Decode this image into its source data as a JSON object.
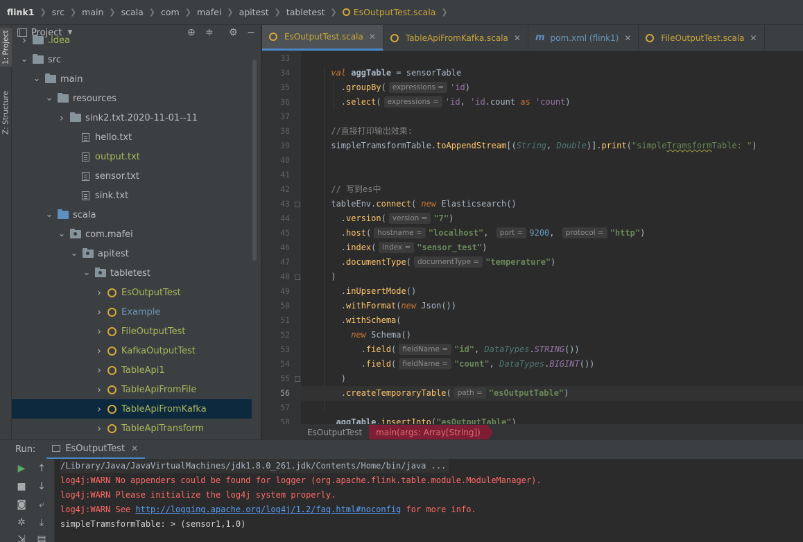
{
  "breadcrumb": {
    "items": [
      "flink1",
      "src",
      "main",
      "scala",
      "com",
      "mafei",
      "apitest",
      "tabletest"
    ],
    "file": "EsOutputTest.scala"
  },
  "toolstrip": {
    "project_tab": "1: Project",
    "structure_tab": "Z: Structure"
  },
  "project_panel": {
    "title": "Project",
    "tree": [
      {
        "label": ".idea",
        "kind": "folder",
        "arrow": "right",
        "color": "olive"
      },
      {
        "label": "src",
        "kind": "folder",
        "arrow": "down",
        "color": "white"
      },
      {
        "label": "main",
        "kind": "folder",
        "arrow": "down",
        "color": "white"
      },
      {
        "label": "resources",
        "kind": "folder",
        "arrow": "down",
        "color": "white"
      },
      {
        "label": "sink2.txt.2020-11-01--11",
        "kind": "folder",
        "arrow": "right",
        "color": "white"
      },
      {
        "label": "hello.txt",
        "kind": "file",
        "arrow": "none",
        "color": "white"
      },
      {
        "label": "output.txt",
        "kind": "file",
        "arrow": "none",
        "color": "olive"
      },
      {
        "label": "sensor.txt",
        "kind": "file",
        "arrow": "none",
        "color": "white"
      },
      {
        "label": "sink.txt",
        "kind": "file",
        "arrow": "none",
        "color": "white"
      },
      {
        "label": "scala",
        "kind": "folder-blue",
        "arrow": "down",
        "color": "white"
      },
      {
        "label": "com.mafei",
        "kind": "package",
        "arrow": "down",
        "color": "white"
      },
      {
        "label": "apitest",
        "kind": "package",
        "arrow": "down",
        "color": "white"
      },
      {
        "label": "tabletest",
        "kind": "package",
        "arrow": "down",
        "color": "white"
      },
      {
        "label": "EsOutputTest",
        "kind": "scala",
        "arrow": "right",
        "color": "olive"
      },
      {
        "label": "Example",
        "kind": "scala",
        "arrow": "right",
        "color": "blue"
      },
      {
        "label": "FileOutputTest",
        "kind": "scala",
        "arrow": "right",
        "color": "olive"
      },
      {
        "label": "KafkaOutputTest",
        "kind": "scala",
        "arrow": "right",
        "color": "olive"
      },
      {
        "label": "TableApi1",
        "kind": "scala",
        "arrow": "right",
        "color": "olive"
      },
      {
        "label": "TableApiFromFile",
        "kind": "scala",
        "arrow": "right",
        "color": "olive"
      },
      {
        "label": "TableApiFromKafka",
        "kind": "scala",
        "arrow": "right",
        "color": "olive",
        "selected": true
      },
      {
        "label": "TableApiTransform",
        "kind": "scala",
        "arrow": "right",
        "color": "olive"
      }
    ]
  },
  "tabs": [
    {
      "label": "EsOutputTest.scala",
      "icon": "scala-icon",
      "active": true
    },
    {
      "label": "TableApiFromKafka.scala",
      "icon": "scala-icon",
      "active": false
    },
    {
      "label": "pom.xml (flink1)",
      "icon": "maven-icon",
      "active": false
    },
    {
      "label": "FileOutputTest.scala",
      "icon": "scala-icon",
      "active": false
    }
  ],
  "editor": {
    "current_line": 56,
    "line_numbers": [
      "33",
      "34",
      "35",
      "36",
      "37",
      "38",
      "39",
      "40",
      "41",
      "42",
      "43",
      "44",
      "45",
      "46",
      "47",
      "48",
      "49",
      "50",
      "51",
      "52",
      "53",
      "54",
      "55",
      "56",
      "57",
      "58"
    ],
    "hints": {
      "expressions": "expressions =",
      "version": "version =",
      "hostname": "hostname =",
      "port": "port =",
      "protocol": "protocol =",
      "index": "index =",
      "documentType": "documentType =",
      "fieldName": "fieldName =",
      "path": "path ="
    },
    "strings": {
      "version_val": "\"7\"",
      "host_val": "\"localhost\"",
      "protocol_val": "\"http\"",
      "index_val": "\"sensor_test\"",
      "doctype_val": "\"temperature\"",
      "field_id": "\"id\"",
      "field_count": "\"count\"",
      "path_val": "\"esOutputTable\"",
      "insert_val": "\"esOutputTable\"",
      "print_prefix": "\"simple",
      "print_squig": "Tramsform",
      "print_suffix": "Table: \""
    },
    "numbers": {
      "port": "9200"
    },
    "comments": {
      "line38": "//直接打印输出效果:",
      "line42": "// 写到es中"
    }
  },
  "editor_breadcrumb": {
    "object": "EsOutputTest",
    "method": "main(args: Array[String])"
  },
  "run_panel": {
    "label": "Run:",
    "tab": "EsOutputTest",
    "lines": [
      "/Library/Java/JavaVirtualMachines/jdk1.8.0_261.jdk/Contents/Home/bin/java ...",
      "log4j:WARN No appenders could be found for logger (org.apache.flink.table.module.ModuleManager).",
      "log4j:WARN Please initialize the log4j system properly.",
      "log4j:WARN See ",
      "simpleTramsformTable: > (sensor1,1.0)"
    ],
    "link": "http://logging.apache.org/log4j/1.2/faq.html#noconfig",
    "link_suffix": " for more info."
  }
}
